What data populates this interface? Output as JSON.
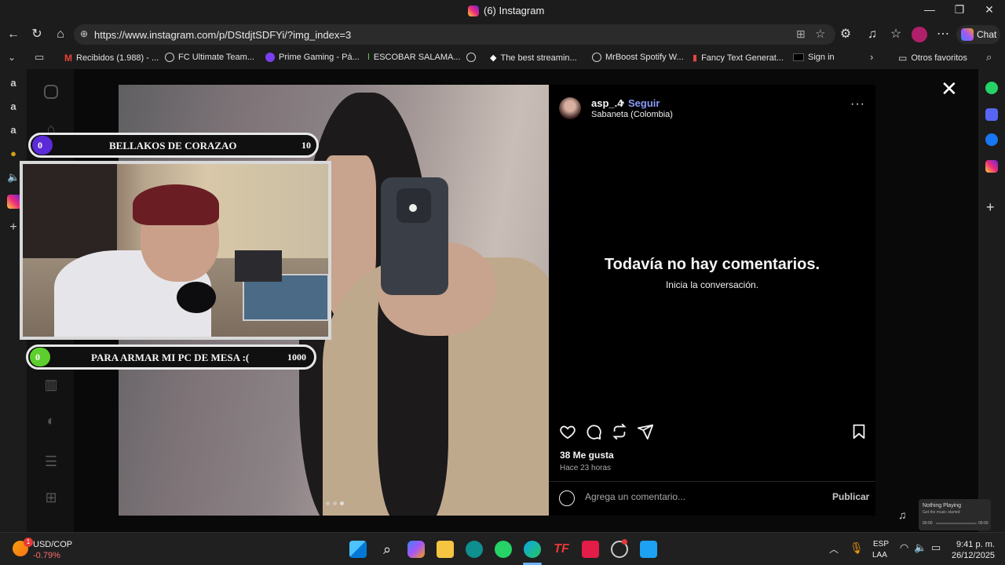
{
  "browser": {
    "tab_title": "(6) Instagram",
    "url": "https://www.instagram.com/p/DStdjtSDFYi/?img_index=3",
    "chat_label": "Chat",
    "bookmarks": [
      "Recibidos (1.988) - ...",
      "FC Ultimate Team...",
      "Prime Gaming - Pá...",
      "ESCOBAR SALAMA...",
      "The best streamin...",
      "MrBoost Spotify W...",
      "Fancy Text Generat...",
      "Sign in"
    ],
    "other_favorites": "Otros favoritos"
  },
  "post": {
    "username": "asp_.4",
    "dot": "•",
    "follow_label": "Seguir",
    "location": "Sabaneta (Colombia)",
    "more": "···",
    "no_comments": "Todavía no hay comentarios.",
    "start_conversation": "Inicia la conversación.",
    "likes": "38 Me gusta",
    "time": "Hace 23 horas",
    "comment_placeholder": "Agrega un comentario...",
    "publish_label": "Publicar",
    "carousel_index": 3,
    "carousel_count": 3
  },
  "stream_overlay": {
    "top_goal": {
      "current": "0",
      "label": "BELLAKOS DE CORAZAO",
      "target": "10",
      "color": "#5b2bd8"
    },
    "bottom_goal": {
      "current": "0",
      "label": "PARA ARMAR MI PC DE MESA :(",
      "target": "1000",
      "color": "#5ccf2e"
    }
  },
  "taskbar": {
    "widget_name": "USD/COP",
    "widget_value": "-0.79%",
    "widget_badge": "1",
    "lang_line1": "ESP",
    "lang_line2": "LAA",
    "time": "9:41 p. m.",
    "date": "26/12/2025"
  },
  "now_playing": {
    "title": "Nothing Playing",
    "subtitle": "Get the music started",
    "elapsed": "00:00",
    "total": "00:00"
  },
  "colors": {
    "accent_link": "#8b9af8",
    "panel_bg": "#000000",
    "page_bg": "#0b0b0b"
  }
}
